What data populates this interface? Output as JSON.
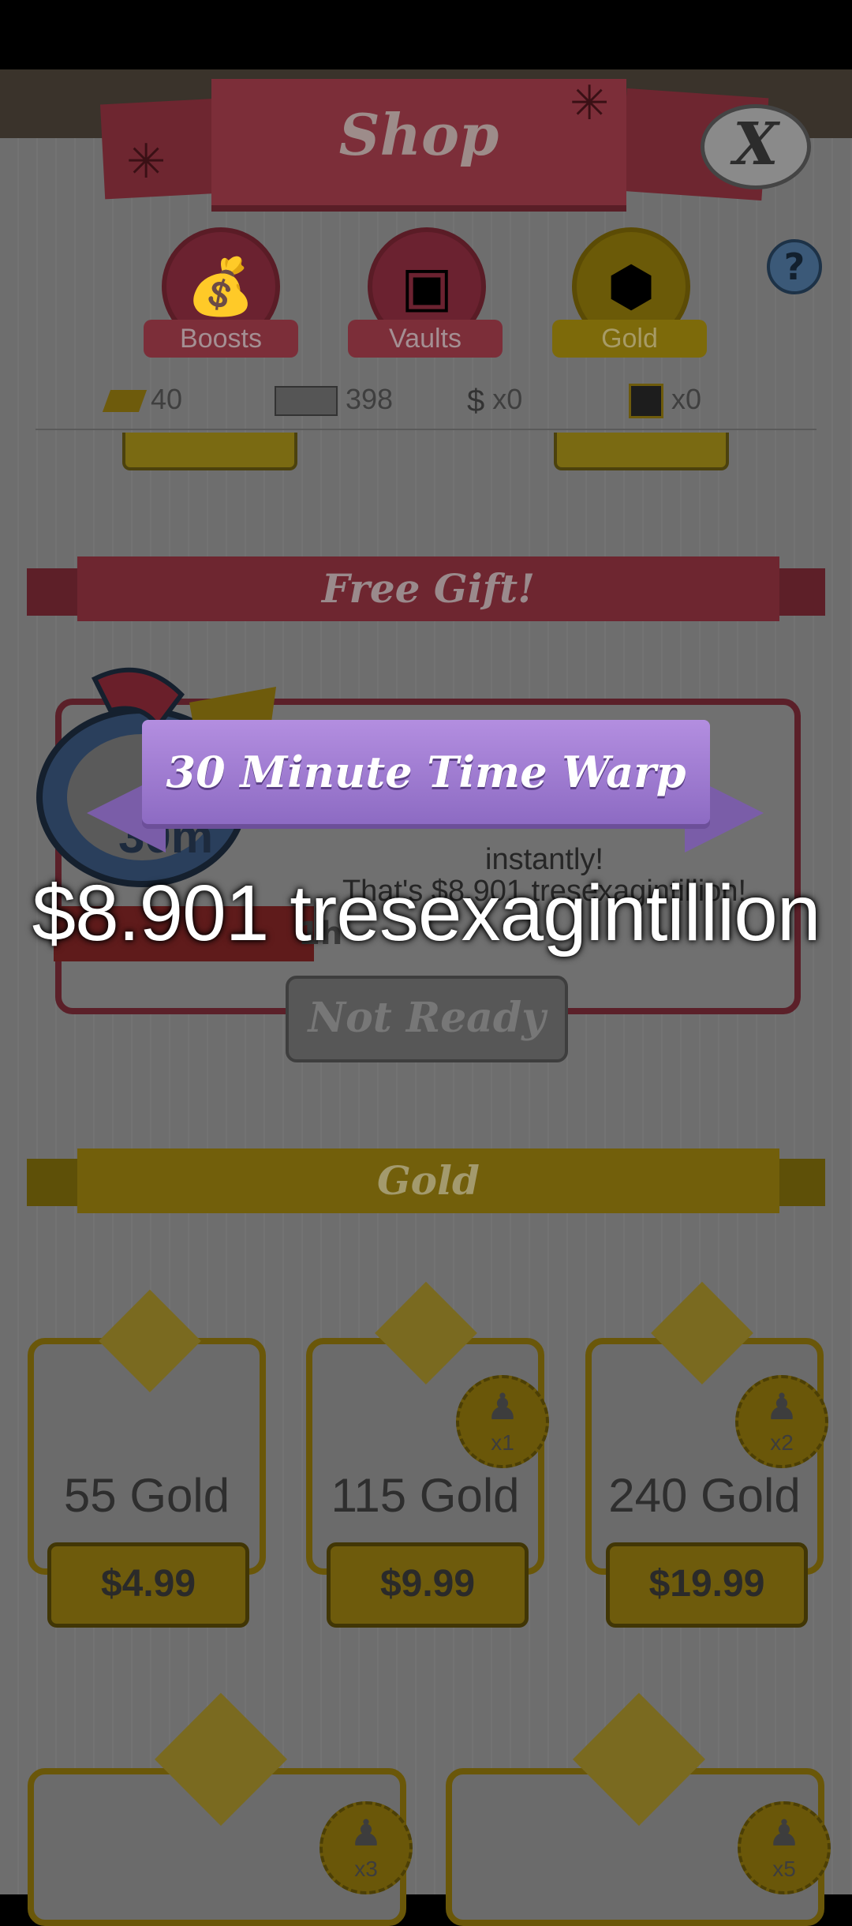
{
  "header": {
    "title": "Shop",
    "close_label": "X"
  },
  "tabs": [
    {
      "label": "Boosts",
      "icon": "boost-bag-icon",
      "active": false
    },
    {
      "label": "Vaults",
      "icon": "vault-icon",
      "active": false
    },
    {
      "label": "Gold",
      "icon": "gold-bar-icon",
      "active": true
    }
  ],
  "help_label": "?",
  "currencies": [
    {
      "icon": "gold-icon",
      "value": "40"
    },
    {
      "icon": "megabucks-icon",
      "value": "398"
    },
    {
      "icon": "money-bag-icon",
      "value": "x0"
    },
    {
      "icon": "mystery-card-icon",
      "value": "x0"
    }
  ],
  "sections": {
    "free_gift": "Free Gift!",
    "gold": "Gold"
  },
  "free_gift": {
    "time_label": "30m",
    "time_text": "1h",
    "description_line1": "instantly!",
    "description_line2": "That's $8.901 tresexagintillion!",
    "button_label": "Not Ready"
  },
  "time_warp": {
    "title": "30 Minute Time Warp",
    "amount": "$8.901 tresexagintillion"
  },
  "gold_packs": [
    {
      "name": "55 Gold",
      "price": "$4.99",
      "badge": ""
    },
    {
      "name": "115 Gold",
      "price": "$9.99",
      "badge": "x1"
    },
    {
      "name": "240 Gold",
      "price": "$19.99",
      "badge": "x2"
    }
  ],
  "gold_packs_row2": [
    {
      "badge": "x3"
    },
    {
      "badge": "x5"
    }
  ],
  "colors": {
    "warp_ribbon": "#b38ee0",
    "shop_header": "#7c2e39",
    "gold_accent": "#725f0b"
  }
}
